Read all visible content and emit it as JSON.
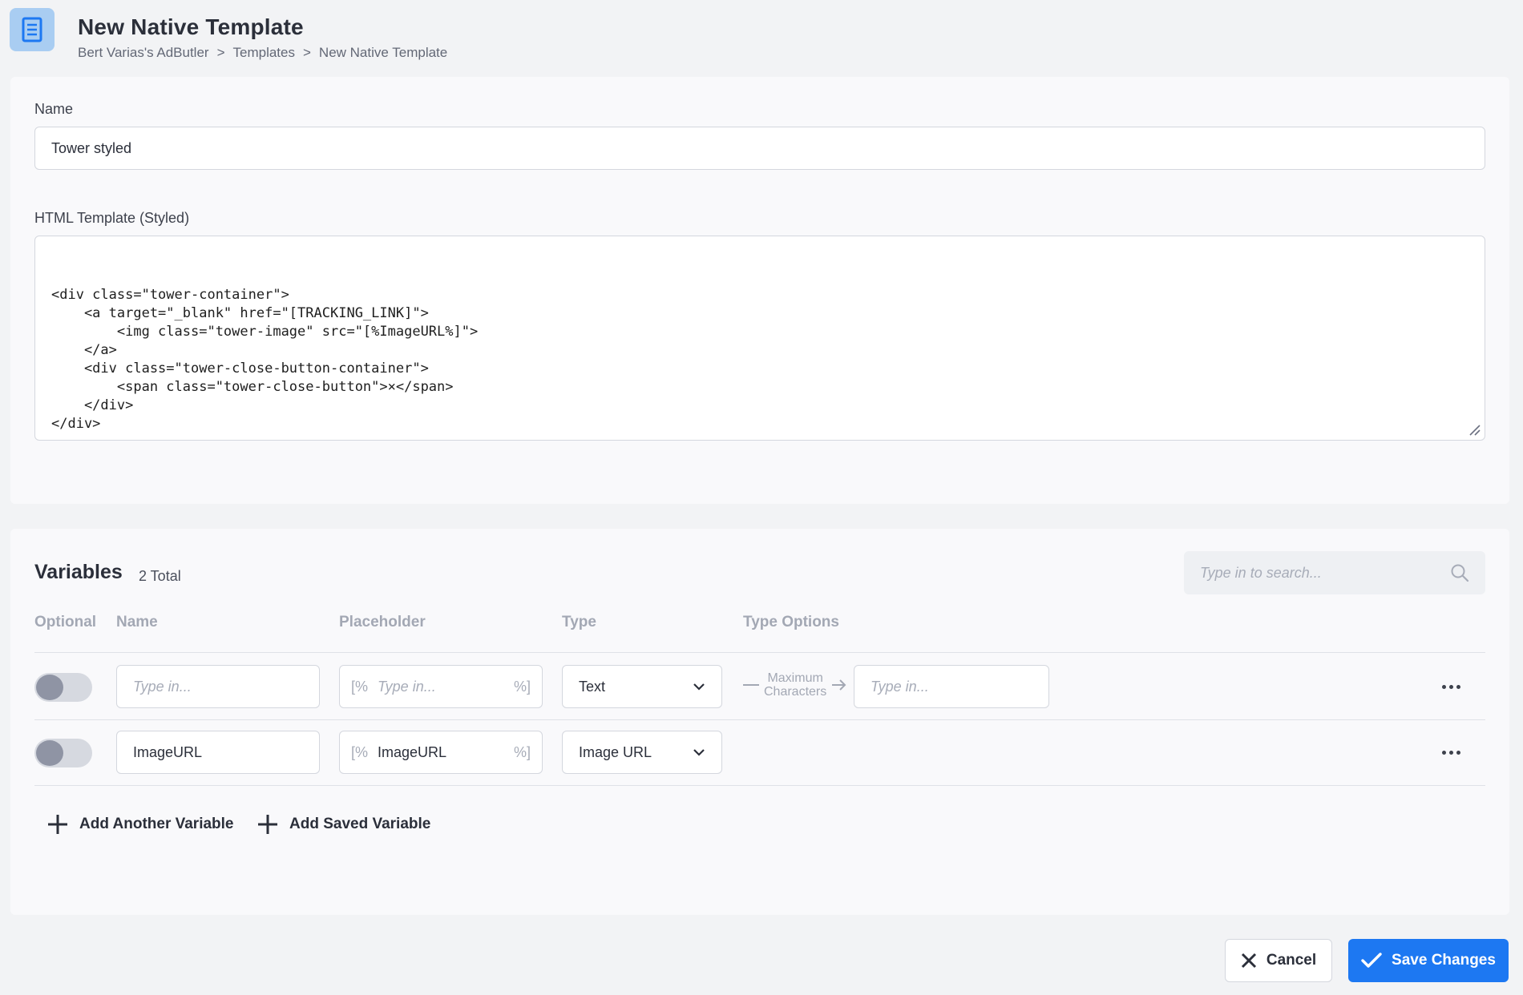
{
  "header": {
    "title": "New Native Template",
    "breadcrumb": [
      "Bert Varias's AdButler",
      "Templates",
      "New Native Template"
    ],
    "breadcrumb_sep": ">"
  },
  "form": {
    "name_label": "Name",
    "name_value": "Tower styled",
    "html_label": "HTML Template (Styled)",
    "html_value": "<div class=\"tower-container\">\n    <a target=\"_blank\" href=\"[TRACKING_LINK]\">\n        <img class=\"tower-image\" src=\"[%ImageURL%]\">\n    </a>\n    <div class=\"tower-close-button-container\">\n        <span class=\"tower-close-button\">×</span>\n    </div>\n</div>"
  },
  "variables": {
    "title": "Variables",
    "count": "2 Total",
    "search_placeholder": "Type in to search...",
    "columns": [
      "Optional",
      "Name",
      "Placeholder",
      "Type",
      "Type Options"
    ],
    "rows": [
      {
        "optional": false,
        "name_placeholder": "Type in...",
        "name_value": "",
        "placeholder_open": "[%",
        "placeholder_hint": "Type in...",
        "placeholder_value": "",
        "placeholder_close": "%]",
        "type": "Text",
        "type_options_label": [
          "Maximum",
          "Characters"
        ],
        "type_options_placeholder": "Type in..."
      },
      {
        "optional": false,
        "name_placeholder": "",
        "name_value": "ImageURL",
        "placeholder_open": "[%",
        "placeholder_hint": "",
        "placeholder_value": "ImageURL",
        "placeholder_close": "%]",
        "type": "Image URL"
      }
    ],
    "add_another": "Add Another Variable",
    "add_saved": "Add Saved Variable"
  },
  "actions": {
    "cancel": "Cancel",
    "save": "Save Changes"
  },
  "colors": {
    "accent": "#1d78f2",
    "icon_bg": "#a9cdf2",
    "background": "#f2f3f5"
  }
}
